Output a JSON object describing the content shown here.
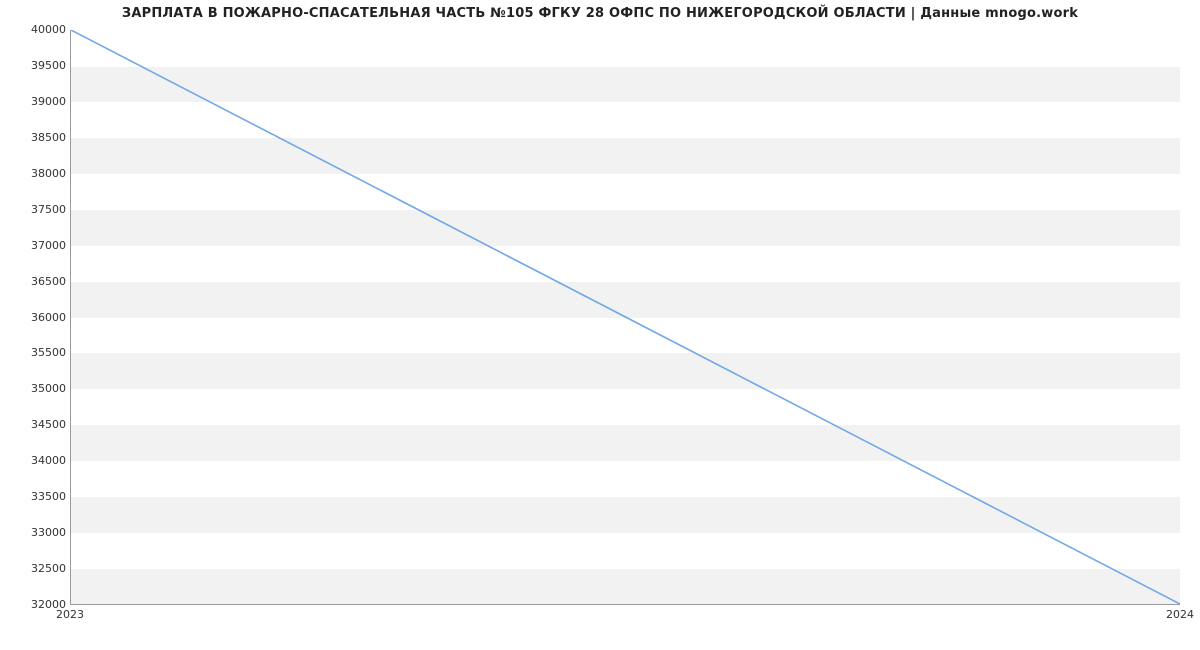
{
  "chart_data": {
    "type": "line",
    "title": "ЗАРПЛАТА В ПОЖАРНО-СПАСАТЕЛЬНАЯ ЧАСТЬ №105 ФГКУ 28 ОФПС ПО НИЖЕГОРОДСКОЙ ОБЛАСТИ | Данные mnogo.work",
    "x": [
      2023,
      2024
    ],
    "values": [
      40000,
      32000
    ],
    "xlabel": "",
    "ylabel": "",
    "xlim": [
      2023,
      2024
    ],
    "ylim": [
      32000,
      40000
    ],
    "yticks": [
      32000,
      32500,
      33000,
      33500,
      34000,
      34500,
      35000,
      35500,
      36000,
      36500,
      37000,
      37500,
      38000,
      38500,
      39000,
      39500,
      40000
    ],
    "xticks": [
      2023,
      2024
    ],
    "line_color": "#6fa8e6",
    "band_color": "#f2f2f2"
  }
}
